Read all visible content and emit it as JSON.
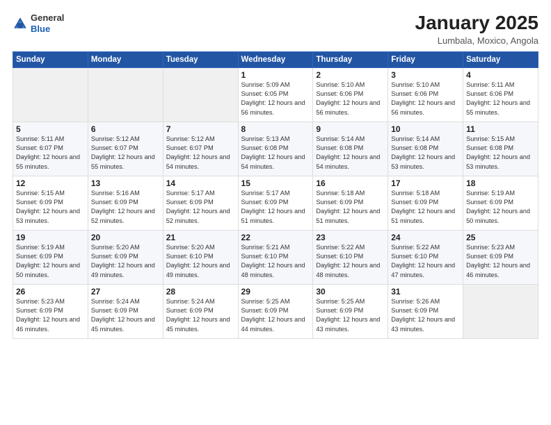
{
  "header": {
    "logo": {
      "line1": "General",
      "line2": "Blue"
    },
    "title": "January 2025",
    "location": "Lumbala, Moxico, Angola"
  },
  "weekdays": [
    "Sunday",
    "Monday",
    "Tuesday",
    "Wednesday",
    "Thursday",
    "Friday",
    "Saturday"
  ],
  "weeks": [
    [
      {
        "day": "",
        "sunrise": "",
        "sunset": "",
        "daylight": ""
      },
      {
        "day": "",
        "sunrise": "",
        "sunset": "",
        "daylight": ""
      },
      {
        "day": "",
        "sunrise": "",
        "sunset": "",
        "daylight": ""
      },
      {
        "day": "1",
        "sunrise": "Sunrise: 5:09 AM",
        "sunset": "Sunset: 6:05 PM",
        "daylight": "Daylight: 12 hours and 56 minutes."
      },
      {
        "day": "2",
        "sunrise": "Sunrise: 5:10 AM",
        "sunset": "Sunset: 6:06 PM",
        "daylight": "Daylight: 12 hours and 56 minutes."
      },
      {
        "day": "3",
        "sunrise": "Sunrise: 5:10 AM",
        "sunset": "Sunset: 6:06 PM",
        "daylight": "Daylight: 12 hours and 56 minutes."
      },
      {
        "day": "4",
        "sunrise": "Sunrise: 5:11 AM",
        "sunset": "Sunset: 6:06 PM",
        "daylight": "Daylight: 12 hours and 55 minutes."
      }
    ],
    [
      {
        "day": "5",
        "sunrise": "Sunrise: 5:11 AM",
        "sunset": "Sunset: 6:07 PM",
        "daylight": "Daylight: 12 hours and 55 minutes."
      },
      {
        "day": "6",
        "sunrise": "Sunrise: 5:12 AM",
        "sunset": "Sunset: 6:07 PM",
        "daylight": "Daylight: 12 hours and 55 minutes."
      },
      {
        "day": "7",
        "sunrise": "Sunrise: 5:12 AM",
        "sunset": "Sunset: 6:07 PM",
        "daylight": "Daylight: 12 hours and 54 minutes."
      },
      {
        "day": "8",
        "sunrise": "Sunrise: 5:13 AM",
        "sunset": "Sunset: 6:08 PM",
        "daylight": "Daylight: 12 hours and 54 minutes."
      },
      {
        "day": "9",
        "sunrise": "Sunrise: 5:14 AM",
        "sunset": "Sunset: 6:08 PM",
        "daylight": "Daylight: 12 hours and 54 minutes."
      },
      {
        "day": "10",
        "sunrise": "Sunrise: 5:14 AM",
        "sunset": "Sunset: 6:08 PM",
        "daylight": "Daylight: 12 hours and 53 minutes."
      },
      {
        "day": "11",
        "sunrise": "Sunrise: 5:15 AM",
        "sunset": "Sunset: 6:08 PM",
        "daylight": "Daylight: 12 hours and 53 minutes."
      }
    ],
    [
      {
        "day": "12",
        "sunrise": "Sunrise: 5:15 AM",
        "sunset": "Sunset: 6:09 PM",
        "daylight": "Daylight: 12 hours and 53 minutes."
      },
      {
        "day": "13",
        "sunrise": "Sunrise: 5:16 AM",
        "sunset": "Sunset: 6:09 PM",
        "daylight": "Daylight: 12 hours and 52 minutes."
      },
      {
        "day": "14",
        "sunrise": "Sunrise: 5:17 AM",
        "sunset": "Sunset: 6:09 PM",
        "daylight": "Daylight: 12 hours and 52 minutes."
      },
      {
        "day": "15",
        "sunrise": "Sunrise: 5:17 AM",
        "sunset": "Sunset: 6:09 PM",
        "daylight": "Daylight: 12 hours and 51 minutes."
      },
      {
        "day": "16",
        "sunrise": "Sunrise: 5:18 AM",
        "sunset": "Sunset: 6:09 PM",
        "daylight": "Daylight: 12 hours and 51 minutes."
      },
      {
        "day": "17",
        "sunrise": "Sunrise: 5:18 AM",
        "sunset": "Sunset: 6:09 PM",
        "daylight": "Daylight: 12 hours and 51 minutes."
      },
      {
        "day": "18",
        "sunrise": "Sunrise: 5:19 AM",
        "sunset": "Sunset: 6:09 PM",
        "daylight": "Daylight: 12 hours and 50 minutes."
      }
    ],
    [
      {
        "day": "19",
        "sunrise": "Sunrise: 5:19 AM",
        "sunset": "Sunset: 6:09 PM",
        "daylight": "Daylight: 12 hours and 50 minutes."
      },
      {
        "day": "20",
        "sunrise": "Sunrise: 5:20 AM",
        "sunset": "Sunset: 6:09 PM",
        "daylight": "Daylight: 12 hours and 49 minutes."
      },
      {
        "day": "21",
        "sunrise": "Sunrise: 5:20 AM",
        "sunset": "Sunset: 6:10 PM",
        "daylight": "Daylight: 12 hours and 49 minutes."
      },
      {
        "day": "22",
        "sunrise": "Sunrise: 5:21 AM",
        "sunset": "Sunset: 6:10 PM",
        "daylight": "Daylight: 12 hours and 48 minutes."
      },
      {
        "day": "23",
        "sunrise": "Sunrise: 5:22 AM",
        "sunset": "Sunset: 6:10 PM",
        "daylight": "Daylight: 12 hours and 48 minutes."
      },
      {
        "day": "24",
        "sunrise": "Sunrise: 5:22 AM",
        "sunset": "Sunset: 6:10 PM",
        "daylight": "Daylight: 12 hours and 47 minutes."
      },
      {
        "day": "25",
        "sunrise": "Sunrise: 5:23 AM",
        "sunset": "Sunset: 6:09 PM",
        "daylight": "Daylight: 12 hours and 46 minutes."
      }
    ],
    [
      {
        "day": "26",
        "sunrise": "Sunrise: 5:23 AM",
        "sunset": "Sunset: 6:09 PM",
        "daylight": "Daylight: 12 hours and 46 minutes."
      },
      {
        "day": "27",
        "sunrise": "Sunrise: 5:24 AM",
        "sunset": "Sunset: 6:09 PM",
        "daylight": "Daylight: 12 hours and 45 minutes."
      },
      {
        "day": "28",
        "sunrise": "Sunrise: 5:24 AM",
        "sunset": "Sunset: 6:09 PM",
        "daylight": "Daylight: 12 hours and 45 minutes."
      },
      {
        "day": "29",
        "sunrise": "Sunrise: 5:25 AM",
        "sunset": "Sunset: 6:09 PM",
        "daylight": "Daylight: 12 hours and 44 minutes."
      },
      {
        "day": "30",
        "sunrise": "Sunrise: 5:25 AM",
        "sunset": "Sunset: 6:09 PM",
        "daylight": "Daylight: 12 hours and 43 minutes."
      },
      {
        "day": "31",
        "sunrise": "Sunrise: 5:26 AM",
        "sunset": "Sunset: 6:09 PM",
        "daylight": "Daylight: 12 hours and 43 minutes."
      },
      {
        "day": "",
        "sunrise": "",
        "sunset": "",
        "daylight": ""
      }
    ]
  ]
}
